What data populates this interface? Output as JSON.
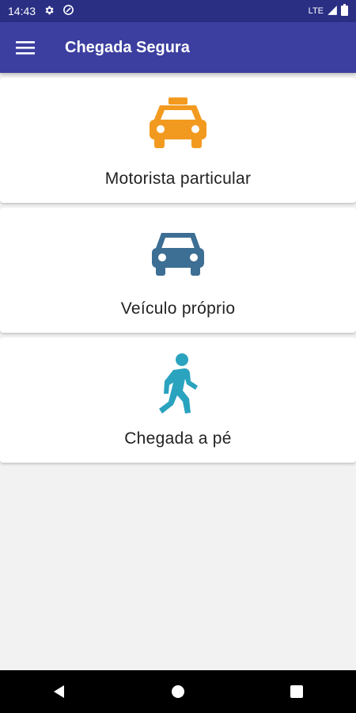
{
  "status_bar": {
    "time": "14:43",
    "network": "LTE",
    "icons": [
      "gear-icon",
      "vpn-icon",
      "signal-icon",
      "battery-icon"
    ]
  },
  "app_bar": {
    "title": "Chegada Segura",
    "menu_icon": "hamburger-menu-icon",
    "background": "#3c3fa0"
  },
  "options": [
    {
      "label": "Motorista particular",
      "icon": "taxi-icon",
      "color": "#f29a1f"
    },
    {
      "label": "Veículo próprio",
      "icon": "car-icon",
      "color": "#3d6e93"
    },
    {
      "label": "Chegada a pé",
      "icon": "walking-person-icon",
      "color": "#2aa3bf"
    }
  ],
  "nav_bar": {
    "buttons": [
      "back-icon",
      "home-icon",
      "recents-icon"
    ]
  }
}
